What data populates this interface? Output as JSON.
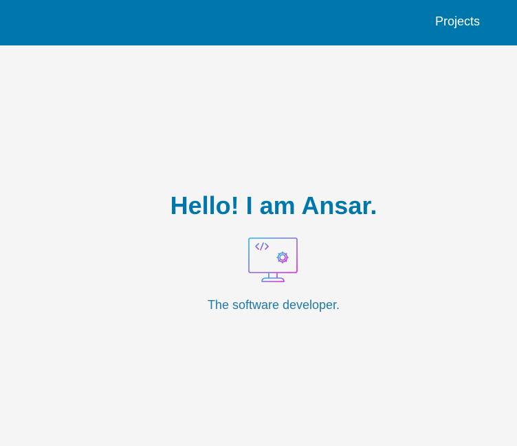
{
  "nav": {
    "links": [
      "Projects"
    ]
  },
  "hero": {
    "title": "Hello! I am Ansar.",
    "subtitle": "The software developer.",
    "icon": "computer-code-settings-icon"
  },
  "colors": {
    "primary": "#0077ac",
    "background": "#f5f5f5",
    "icon_gradient_start": "#22b8e8",
    "icon_gradient_end": "#e020e0"
  }
}
